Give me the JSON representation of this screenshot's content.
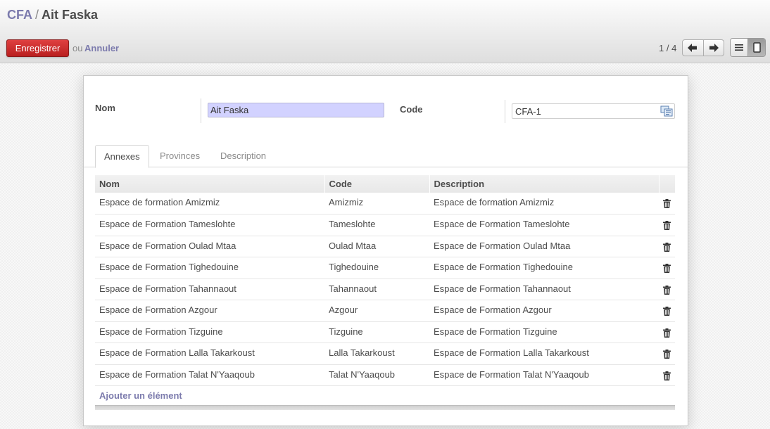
{
  "breadcrumb": {
    "parent": "CFA",
    "separator": "/",
    "current": "Ait Faska"
  },
  "toolbar": {
    "save_label": "Enregistrer",
    "or_text": "ou",
    "cancel_label": "Annuler"
  },
  "pager": {
    "text": "1 / 4"
  },
  "form": {
    "nom_label": "Nom",
    "nom_value": "Ait Faska",
    "code_label": "Code",
    "code_value": "CFA-1"
  },
  "tabs": [
    {
      "label": "Annexes",
      "active": true
    },
    {
      "label": "Provinces",
      "active": false
    },
    {
      "label": "Description",
      "active": false
    }
  ],
  "table": {
    "headers": [
      "Nom",
      "Code",
      "Description"
    ],
    "rows": [
      [
        "Espace de formation Amizmiz",
        "Amizmiz",
        "Espace de formation Amizmiz"
      ],
      [
        "Espace de Formation Tameslohte",
        "Tameslohte",
        "Espace de Formation Tameslohte"
      ],
      [
        "Espace de Formation Oulad Mtaa",
        "Oulad Mtaa",
        "Espace de Formation Oulad Mtaa"
      ],
      [
        "Espace de Formation Tighedouine",
        "Tighedouine",
        "Espace de Formation Tighedouine"
      ],
      [
        "Espace de Formation Tahannaout",
        "Tahannaout",
        "Espace de Formation Tahannaout"
      ],
      [
        "Espace de Formation Azgour",
        "Azgour",
        "Espace de Formation Azgour"
      ],
      [
        "Espace de Formation Tizguine",
        "Tizguine",
        "Espace de Formation Tizguine"
      ],
      [
        "Espace de Formation Lalla Takarkoust",
        "Lalla Takarkoust",
        "Espace de Formation Lalla Takarkoust"
      ],
      [
        "Espace de Formation Talat N'Yaaqoub",
        "Talat N'Yaaqoub",
        "Espace de Formation Talat N'Yaaqoub"
      ]
    ],
    "add_label": "Ajouter un élément"
  },
  "colors": {
    "accent": "#7c7bad",
    "save": "#d32f2f",
    "input_focus": "#d2d2ff"
  }
}
